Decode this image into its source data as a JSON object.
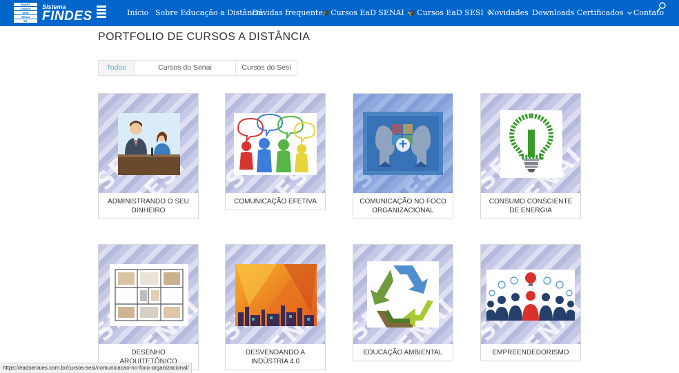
{
  "header": {
    "logo": {
      "stack_lines": [
        "FINDES",
        "CINDES",
        "SESI",
        "SENAI",
        "IEL",
        "IDEIES"
      ],
      "brand_small": "Sistema",
      "brand_big": "FINDES"
    },
    "nav": [
      {
        "label": "Início"
      },
      {
        "label": "Sobre Educação a Distância"
      },
      {
        "label": "Dúvidas frequentes"
      },
      {
        "label": "Cursos EaD SENAI",
        "icon": "graduation-cap-icon",
        "dropdown": true
      },
      {
        "label": "Cursos EaD SESI",
        "icon": "graduation-cap-icon",
        "dropdown": true
      },
      {
        "label": "Novidades"
      },
      {
        "label": "Downloads"
      },
      {
        "label": "Certificados",
        "dropdown": true
      },
      {
        "label": "Contato"
      }
    ],
    "accent_color": "#0066cc"
  },
  "page": {
    "title": "PORTFOLIO DE CURSOS A DISTÂNCIA",
    "filters": [
      {
        "label": "Todos",
        "active": true
      },
      {
        "label": "Cursos do Senai",
        "active": false
      },
      {
        "label": "Cursos do Sesi",
        "active": false
      }
    ]
  },
  "courses": [
    {
      "title": "ADMINISTRANDO O SEU DINHEIRO",
      "watermark": "SESI",
      "image": "news-anchors-illustration"
    },
    {
      "title": "COMUNICAÇÃO EFETIVA",
      "watermark": "SESI",
      "image": "people-speech-bubbles-illustration"
    },
    {
      "title": "COMUNICAÇÃO NO FOCO ORGANIZACIONAL",
      "watermark": "SESI",
      "image": "faces-puzzle-illustration",
      "hover": true
    },
    {
      "title": "CONSUMO CONSCIENTE DE ENERGIA",
      "watermark": "SENAI",
      "image": "green-lightbulb-illustration"
    },
    {
      "title": "DESENHO ARQUITETÔNICO",
      "watermark": "SENAI",
      "image": "floor-plan-illustration"
    },
    {
      "title": "DESVENDANDO A INDÚSTRIA 4.0",
      "watermark": "SENAI",
      "image": "industry-skyline-illustration"
    },
    {
      "title": "EDUCAÇÃO AMBIENTAL",
      "watermark": "SENAI",
      "image": "recycling-symbol-illustration"
    },
    {
      "title": "EMPREENDEDORISMO",
      "watermark": "SENAI",
      "image": "lightbulb-leader-illustration"
    }
  ],
  "statusbar": {
    "url": "https://eadsenaies.com.br/cursos-sesi/comunicacao-no-foco-organizacional/"
  }
}
